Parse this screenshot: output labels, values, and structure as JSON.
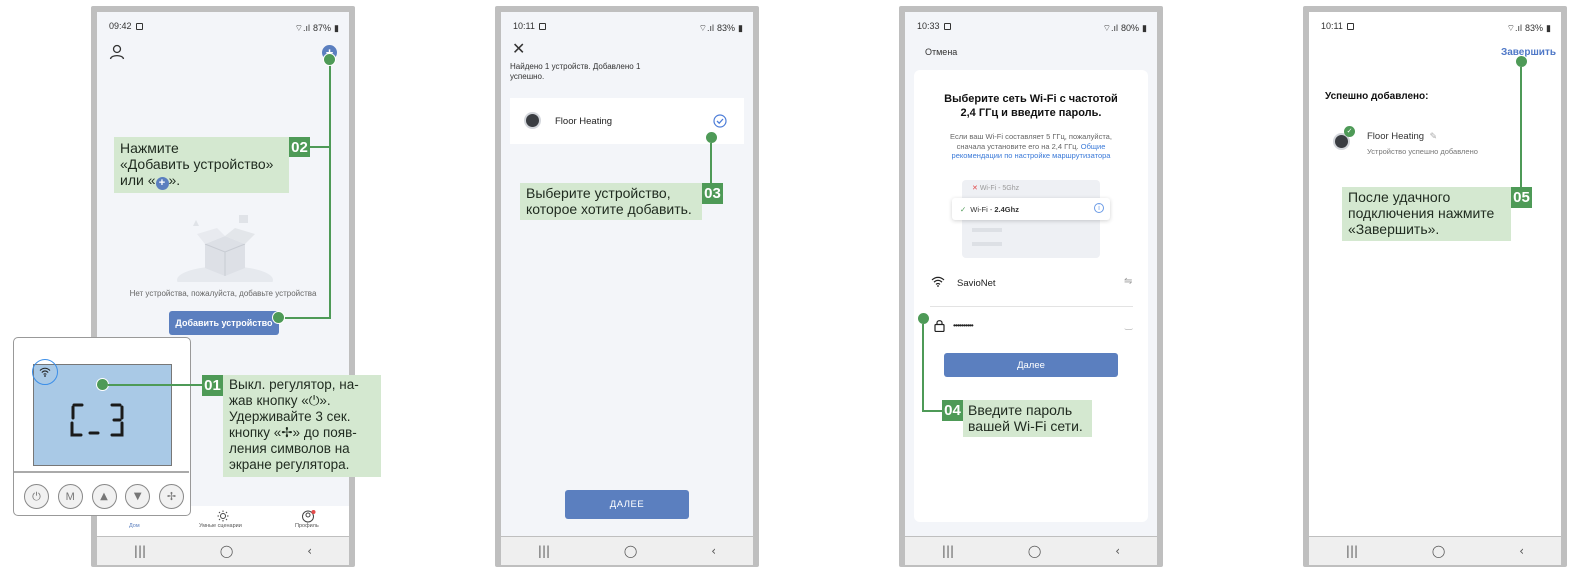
{
  "colors": {
    "accent": "#5b7fbf",
    "callout_bg": "#d4e8d0",
    "callout_badge": "#4e9a57"
  },
  "nav": {
    "recent": "|||",
    "home": "◯",
    "back": "‹"
  },
  "screen1": {
    "time": "09:42",
    "battery": "87%",
    "empty_text": "Нет устройства, пожалуйста, добавьте устройства",
    "add_button": "Добавить устройство",
    "tabs": [
      "Дом",
      "Умные сценарии",
      "Профиль"
    ],
    "step_num": "02",
    "step_text": [
      "Нажмите",
      "«Добавить устройство»",
      "или «",
      "»."
    ],
    "step1_num": "01",
    "step1_text": [
      "Выкл. регулятор, на-",
      "жав кнопку «⏻».",
      "Удерживайте 3 сек.",
      "кнопку «✢» до появ-",
      "ления символов на",
      "экране регулятора."
    ],
    "thermostat_buttons": [
      "⏻",
      "M",
      "▲",
      "▼",
      "✢"
    ]
  },
  "screen2": {
    "time": "10:11",
    "battery": "83%",
    "found_text": [
      "Найдено 1 устройств. Добавлено 1",
      "успешно."
    ],
    "device_name": "Floor Heating",
    "next_button": "ДАЛЕЕ",
    "step_num": "03",
    "step_text": [
      "Выберите устройство,",
      "которое хотите добавить."
    ]
  },
  "screen3": {
    "time": "10:33",
    "battery": "80%",
    "cancel": "Отмена",
    "heading": [
      "Выберите сеть Wi-Fi с частотой",
      "2,4 ГГц и введите пароль."
    ],
    "info": [
      "Если ваш Wi-Fi составляет 5 ГГц, пожалуйста,",
      "сначала установите его на 2,4 ГГц."
    ],
    "info_link": [
      "Общие",
      "рекомендации по настройке маршрутизатора"
    ],
    "wifi_5": "Wi-Fi - 5Ghz",
    "wifi_24_prefix": "Wi-Fi - ",
    "wifi_24_band": "2.4Ghz",
    "ssid": "SavioNet",
    "password": "••••••••••",
    "next_button": "Далее",
    "step_num": "04",
    "step_text": [
      "Введите пароль",
      "вашей Wi-Fi сети."
    ]
  },
  "screen4": {
    "time": "10:11",
    "battery": "83%",
    "finish": "Завершить",
    "success_title": "Успешно добавлено:",
    "device_name": "Floor Heating",
    "device_status": "Устройство успешно добавлено",
    "step_num": "05",
    "step_text": [
      "После удачного",
      "подключения нажмите",
      "«Завершить»."
    ]
  }
}
